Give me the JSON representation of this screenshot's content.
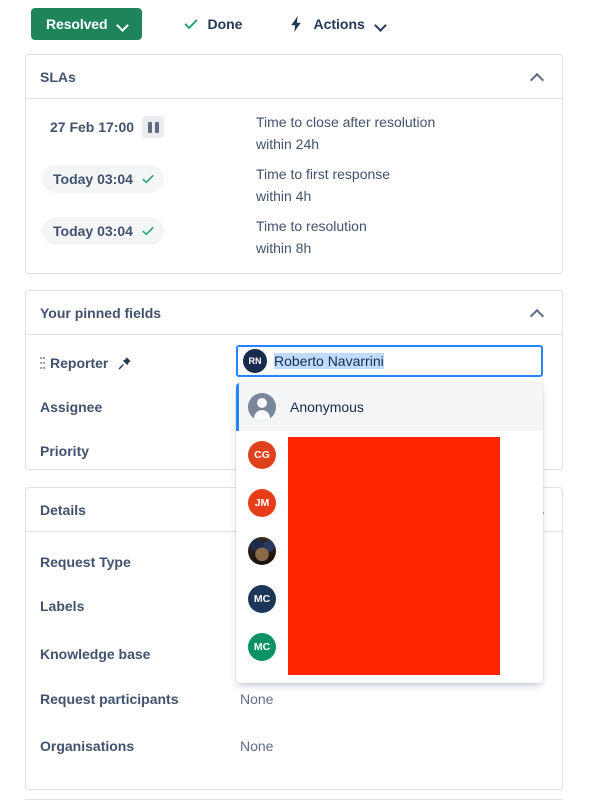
{
  "toolbar": {
    "status_button": {
      "label": "Resolved",
      "color": "#1F845A",
      "chevron": "chevron-down-icon"
    },
    "done": {
      "label": "Done",
      "icon": "check-icon",
      "icon_color": "#22A06B"
    },
    "actions": {
      "label": "Actions",
      "icon": "lightning-bolt-icon",
      "chevron": "chevron-down-icon"
    }
  },
  "slas": {
    "title": "SLAs",
    "collapse_icon": "chevron-up-icon",
    "rows": [
      {
        "time": "27 Feb 17:00",
        "state_icon": "pause-icon",
        "name": "Time to close after resolution",
        "target": "within 24h",
        "pill": false
      },
      {
        "time": "Today 03:04",
        "state_icon": "check-icon",
        "name": "Time to first response",
        "target": "within 4h",
        "pill": true
      },
      {
        "time": "Today 03:04",
        "state_icon": "check-icon",
        "name": "Time to resolution",
        "target": "within 8h",
        "pill": true
      }
    ]
  },
  "pinned": {
    "title": "Your pinned fields",
    "collapse_icon": "chevron-up-icon",
    "fields": [
      {
        "label": "Reporter",
        "pinned": true
      },
      {
        "label": "Assignee",
        "pinned": false
      },
      {
        "label": "Priority",
        "pinned": false
      }
    ],
    "reporter_input": {
      "value": "Roberto Navarrini",
      "avatar_initials": "RN",
      "avatar_color": "#172B4D",
      "selected": true,
      "focus_color": "#2684FF",
      "selection_color": "#BFDBFD"
    }
  },
  "dropdown": {
    "options": [
      {
        "name": "Anonymous",
        "avatar_type": "anonymous-icon",
        "avatar_initials": "",
        "avatar_color": "#7A869A",
        "selected": true,
        "redacted": false
      },
      {
        "name": "",
        "avatar_type": "initials",
        "avatar_initials": "CG",
        "avatar_color": "#E0411C",
        "selected": false,
        "redacted": true
      },
      {
        "name": "",
        "avatar_type": "initials",
        "avatar_initials": "JM",
        "avatar_color": "#E83D18",
        "selected": false,
        "redacted": true
      },
      {
        "name": "",
        "avatar_type": "photo",
        "avatar_initials": "",
        "avatar_color": "#3C2E22",
        "selected": false,
        "redacted": true
      },
      {
        "name": "",
        "avatar_type": "initials",
        "avatar_initials": "MC",
        "avatar_color": "#1D3557",
        "selected": false,
        "redacted": true
      },
      {
        "name": "",
        "avatar_type": "initials",
        "avatar_initials": "MC",
        "avatar_color": "#0B9367",
        "selected": false,
        "redacted": true
      }
    ],
    "redaction_color": "#FF2600"
  },
  "details": {
    "title": "Details",
    "collapse_icon": "chevron-up-icon",
    "rows": [
      {
        "label": "Request Type",
        "value": ""
      },
      {
        "label": "Labels",
        "value": ""
      },
      {
        "label": "Knowledge base",
        "value": ""
      },
      {
        "label": "Request participants",
        "value": "None"
      },
      {
        "label": "Organisations",
        "value": "None"
      }
    ]
  }
}
